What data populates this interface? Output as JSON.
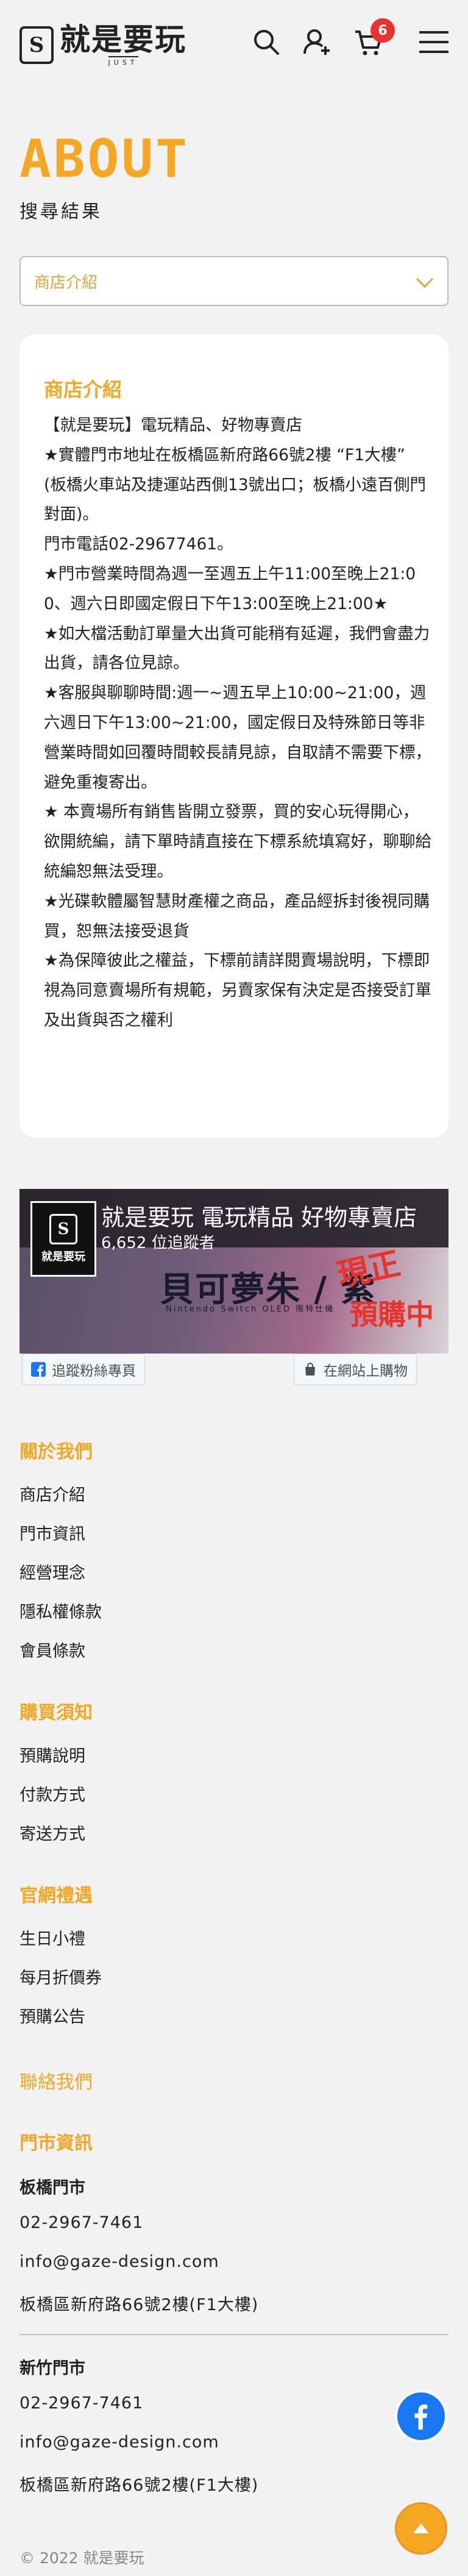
{
  "header": {
    "logo_mark": "S",
    "logo_text": "就是要玩",
    "logo_sub": "JUST",
    "cart_count": "6",
    "icons": [
      "search-icon",
      "user-add-icon",
      "cart-icon",
      "menu-icon"
    ]
  },
  "page": {
    "title": "ABOUT",
    "subtitle": "搜尋結果",
    "select_value": "商店介紹"
  },
  "card": {
    "title": "商店介紹",
    "lines": [
      "【就是要玩】電玩精品、好物專賣店",
      "★實體門市地址在板橋區新府路66號2樓 “F1大樓”",
      "(板橋火車站及捷運站西側13號出口；板橋小遠百側門對面)。",
      "門市電話02-29677461。",
      "★門市營業時間為週一至週五上午11:00至晚上21:00、週六日即國定假日下午13:00至晚上21:00★",
      "★如大檔活動訂單量大出貨可能稍有延遲，我們會盡力出貨，請各位見諒。",
      "★客服與聊聊時間:週一~週五早上10:00~21:00，週六週日下午13:00~21:00，國定假日及特殊節日等非營業時間如回覆時間較長請見諒，自取請不需要下標，避免重複寄出。",
      "★ 本賣場所有銷售皆開立發票，買的安心玩得開心，欲開統編，請下單時請直接在下標系統填寫好，聊聊給統編恕無法受理。",
      "★光碟軟體屬智慧財產權之商品，產品經拆封後視同購買，恕無法接受退貨",
      "★為保障彼此之權益，下標前請詳閱賣場說明，下標即視為同意賣場所有規範，另賣家保有決定是否接受訂單及出貨與否之權利"
    ]
  },
  "fb_banner": {
    "page_name": "就是要玩 電玩精品 好物專賣店",
    "followers": "6,652 位追蹤者",
    "logo_text": "就是要玩",
    "art_main": "貝可夢朱 / 紫",
    "art_sub": "Nintendo Switch OLED 限特仕機",
    "art_badge1": "現正",
    "art_badge2": "預購中",
    "follow_label": "追蹤粉絲專頁",
    "shop_label": "在網站上購物"
  },
  "footer": {
    "about": {
      "title": "關於我們",
      "links": [
        "商店介紹",
        "門市資訊",
        "經營理念",
        "隱私權條款",
        "會員條款"
      ]
    },
    "buying": {
      "title": "購買須知",
      "links": [
        "預購說明",
        "付款方式",
        "寄送方式"
      ]
    },
    "benefits": {
      "title": "官網禮遇",
      "links": [
        "生日小禮",
        "每月折價券",
        "預購公告"
      ]
    },
    "contact_title": "聯絡我們",
    "stores_title": "門市資訊",
    "stores": [
      {
        "name": "板橋門市",
        "phone": "02-2967-7461",
        "email": "info@gaze-design.com",
        "address": "板橋區新府路66號2樓(F1大樓)"
      },
      {
        "name": "新竹門市",
        "phone": "02-2967-7461",
        "email": "info@gaze-design.com",
        "address": "板橋區新府路66號2樓(F1大樓)"
      }
    ],
    "copyright": "© 2022 就是要玩"
  },
  "floating": {
    "fb_icon": "facebook-icon",
    "top_icon": "arrow-up-icon"
  },
  "colors": {
    "accent": "#f5a623",
    "badge": "#e8322c",
    "facebook": "#1877f2",
    "background": "#f2f2f2"
  }
}
